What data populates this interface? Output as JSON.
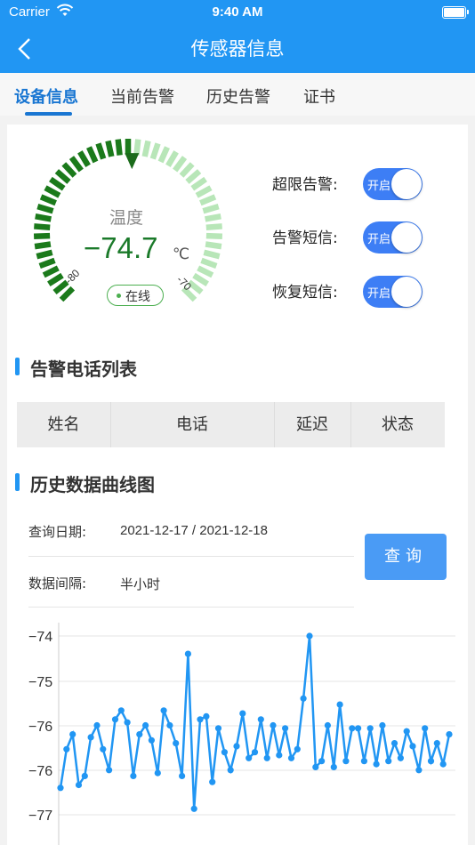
{
  "status_bar": {
    "carrier": "Carrier",
    "time": "9:40 AM"
  },
  "nav": {
    "title": "传感器信息"
  },
  "tabs": [
    {
      "label": "设备信息",
      "active": true
    },
    {
      "label": "当前告警",
      "active": false
    },
    {
      "label": "历史告警",
      "active": false
    },
    {
      "label": "证书",
      "active": false
    }
  ],
  "gauge": {
    "label": "温度",
    "value": "−74.7",
    "unit": "℃",
    "min_label": "-80",
    "max_label": "-70",
    "status": "在线",
    "colors": {
      "active": "#1b7a1b",
      "inactive": "#b8e6b8",
      "status": "#4caf50"
    }
  },
  "switches": [
    {
      "label": "超限告警:",
      "state": "开启",
      "on": true
    },
    {
      "label": "告警短信:",
      "state": "开启",
      "on": true
    },
    {
      "label": "恢复短信:",
      "state": "开启",
      "on": true
    }
  ],
  "phone_list": {
    "title": "告警电话列表",
    "columns": [
      "姓名",
      "电话",
      "延迟",
      "状态"
    ]
  },
  "history": {
    "title": "历史数据曲线图",
    "date_label": "查询日期:",
    "date_value": "2021-12-17 / 2021-12-18",
    "interval_label": "数据间隔:",
    "interval_value": "半小时",
    "query_button": "查询"
  },
  "chart_data": {
    "type": "line",
    "ytick_labels": [
      "−74",
      "−75",
      "−76",
      "−76",
      "−77"
    ],
    "ylim": [
      -77,
      -74
    ],
    "grid": true,
    "color": "#2196f3",
    "values": [
      -76.55,
      -75.9,
      -75.65,
      -76.5,
      -76.35,
      -75.7,
      -75.5,
      -75.9,
      -76.25,
      -75.4,
      -75.25,
      -75.45,
      -76.35,
      -75.65,
      -75.5,
      -75.75,
      -76.3,
      -75.25,
      -75.5,
      -75.8,
      -76.35,
      -74.3,
      -76.9,
      -75.4,
      -75.35,
      -76.45,
      -75.55,
      -75.95,
      -76.25,
      -75.85,
      -75.3,
      -76.05,
      -75.95,
      -75.4,
      -76.05,
      -75.5,
      -76.0,
      -75.55,
      -76.05,
      -75.9,
      -75.05,
      -74.0,
      -76.2,
      -76.1,
      -75.5,
      -76.2,
      -75.15,
      -76.1,
      -75.55,
      -75.55,
      -76.1,
      -75.55,
      -76.15,
      -75.5,
      -76.1,
      -75.8,
      -76.05,
      -75.6,
      -75.85,
      -76.25,
      -75.55,
      -76.1,
      -75.8,
      -76.15,
      -75.65
    ]
  }
}
